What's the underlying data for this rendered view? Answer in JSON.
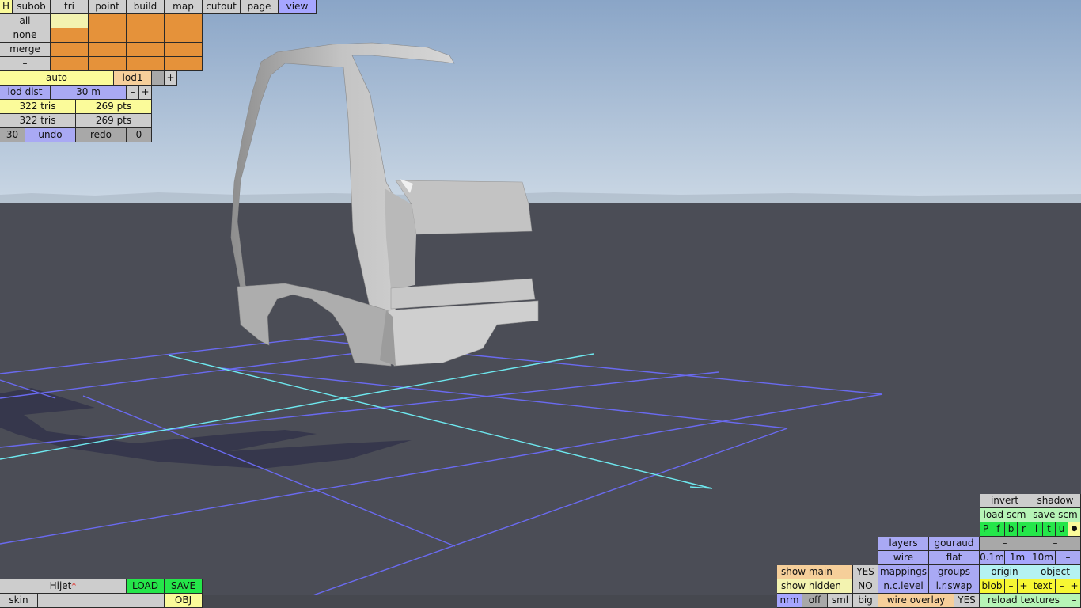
{
  "colors": {
    "sky_top": "#8aa5c7",
    "sky_bottom": "#c9d6e3",
    "ground": "#4b4d56",
    "grid": "#6a6af0",
    "axis": "#6ee8ef"
  },
  "topbar": {
    "h": "H",
    "tabs": [
      "subob",
      "tri",
      "point",
      "build",
      "map",
      "cutout",
      "page",
      "view"
    ],
    "active_tab": "view"
  },
  "selection": {
    "all": "all",
    "none": "none",
    "merge": "merge",
    "dash": "–"
  },
  "lod": {
    "auto": "auto",
    "level": "lod1",
    "minus": "–",
    "plus": "+",
    "dist_label": "lod dist",
    "dist_value": "30 m",
    "dist_minus": "–",
    "dist_plus": "+"
  },
  "stats": {
    "row1_tris": "322 tris",
    "row1_pts": "269 pts",
    "row2_tris": "322 tris",
    "row2_pts": "269 pts"
  },
  "history": {
    "count": "30",
    "undo": "undo",
    "redo": "redo",
    "redo_count": "0"
  },
  "file": {
    "name": "Hijet",
    "modified_mark": "*",
    "load": "LOAD",
    "save": "SAVE",
    "skin": "skin",
    "obj": "OBJ"
  },
  "view_panel": {
    "invert": "invert",
    "shadow": "shadow",
    "load_scm": "load scm",
    "save_scm": "save scm",
    "views": [
      "P",
      "f",
      "b",
      "r",
      "l",
      "t",
      "u"
    ],
    "dot": "●",
    "layers": "layers",
    "gouraud": "gouraud",
    "dash1": "–",
    "dash2": "–",
    "wire": "wire",
    "flat": "flat",
    "g01": "0.1m",
    "g1": "1m",
    "g10": "10m",
    "gminus": "–",
    "show_main": "show main",
    "show_main_val": "YES",
    "mappings": "mappings",
    "groups": "groups",
    "origin": "origin",
    "object": "object",
    "show_hidden": "show hidden",
    "show_hidden_val": "NO",
    "nclevel": "n.c.level",
    "lrswap": "l.r.swap",
    "blob": "blob",
    "blob_minus": "–",
    "blob_plus": "+",
    "text": "text",
    "text_minus": "–",
    "text_plus": "+",
    "nrm": "nrm",
    "off": "off",
    "sml": "sml",
    "big": "big",
    "wire_overlay": "wire overlay",
    "wire_overlay_val": "YES",
    "reload_textures": "reload textures",
    "rt_minus": "–"
  }
}
